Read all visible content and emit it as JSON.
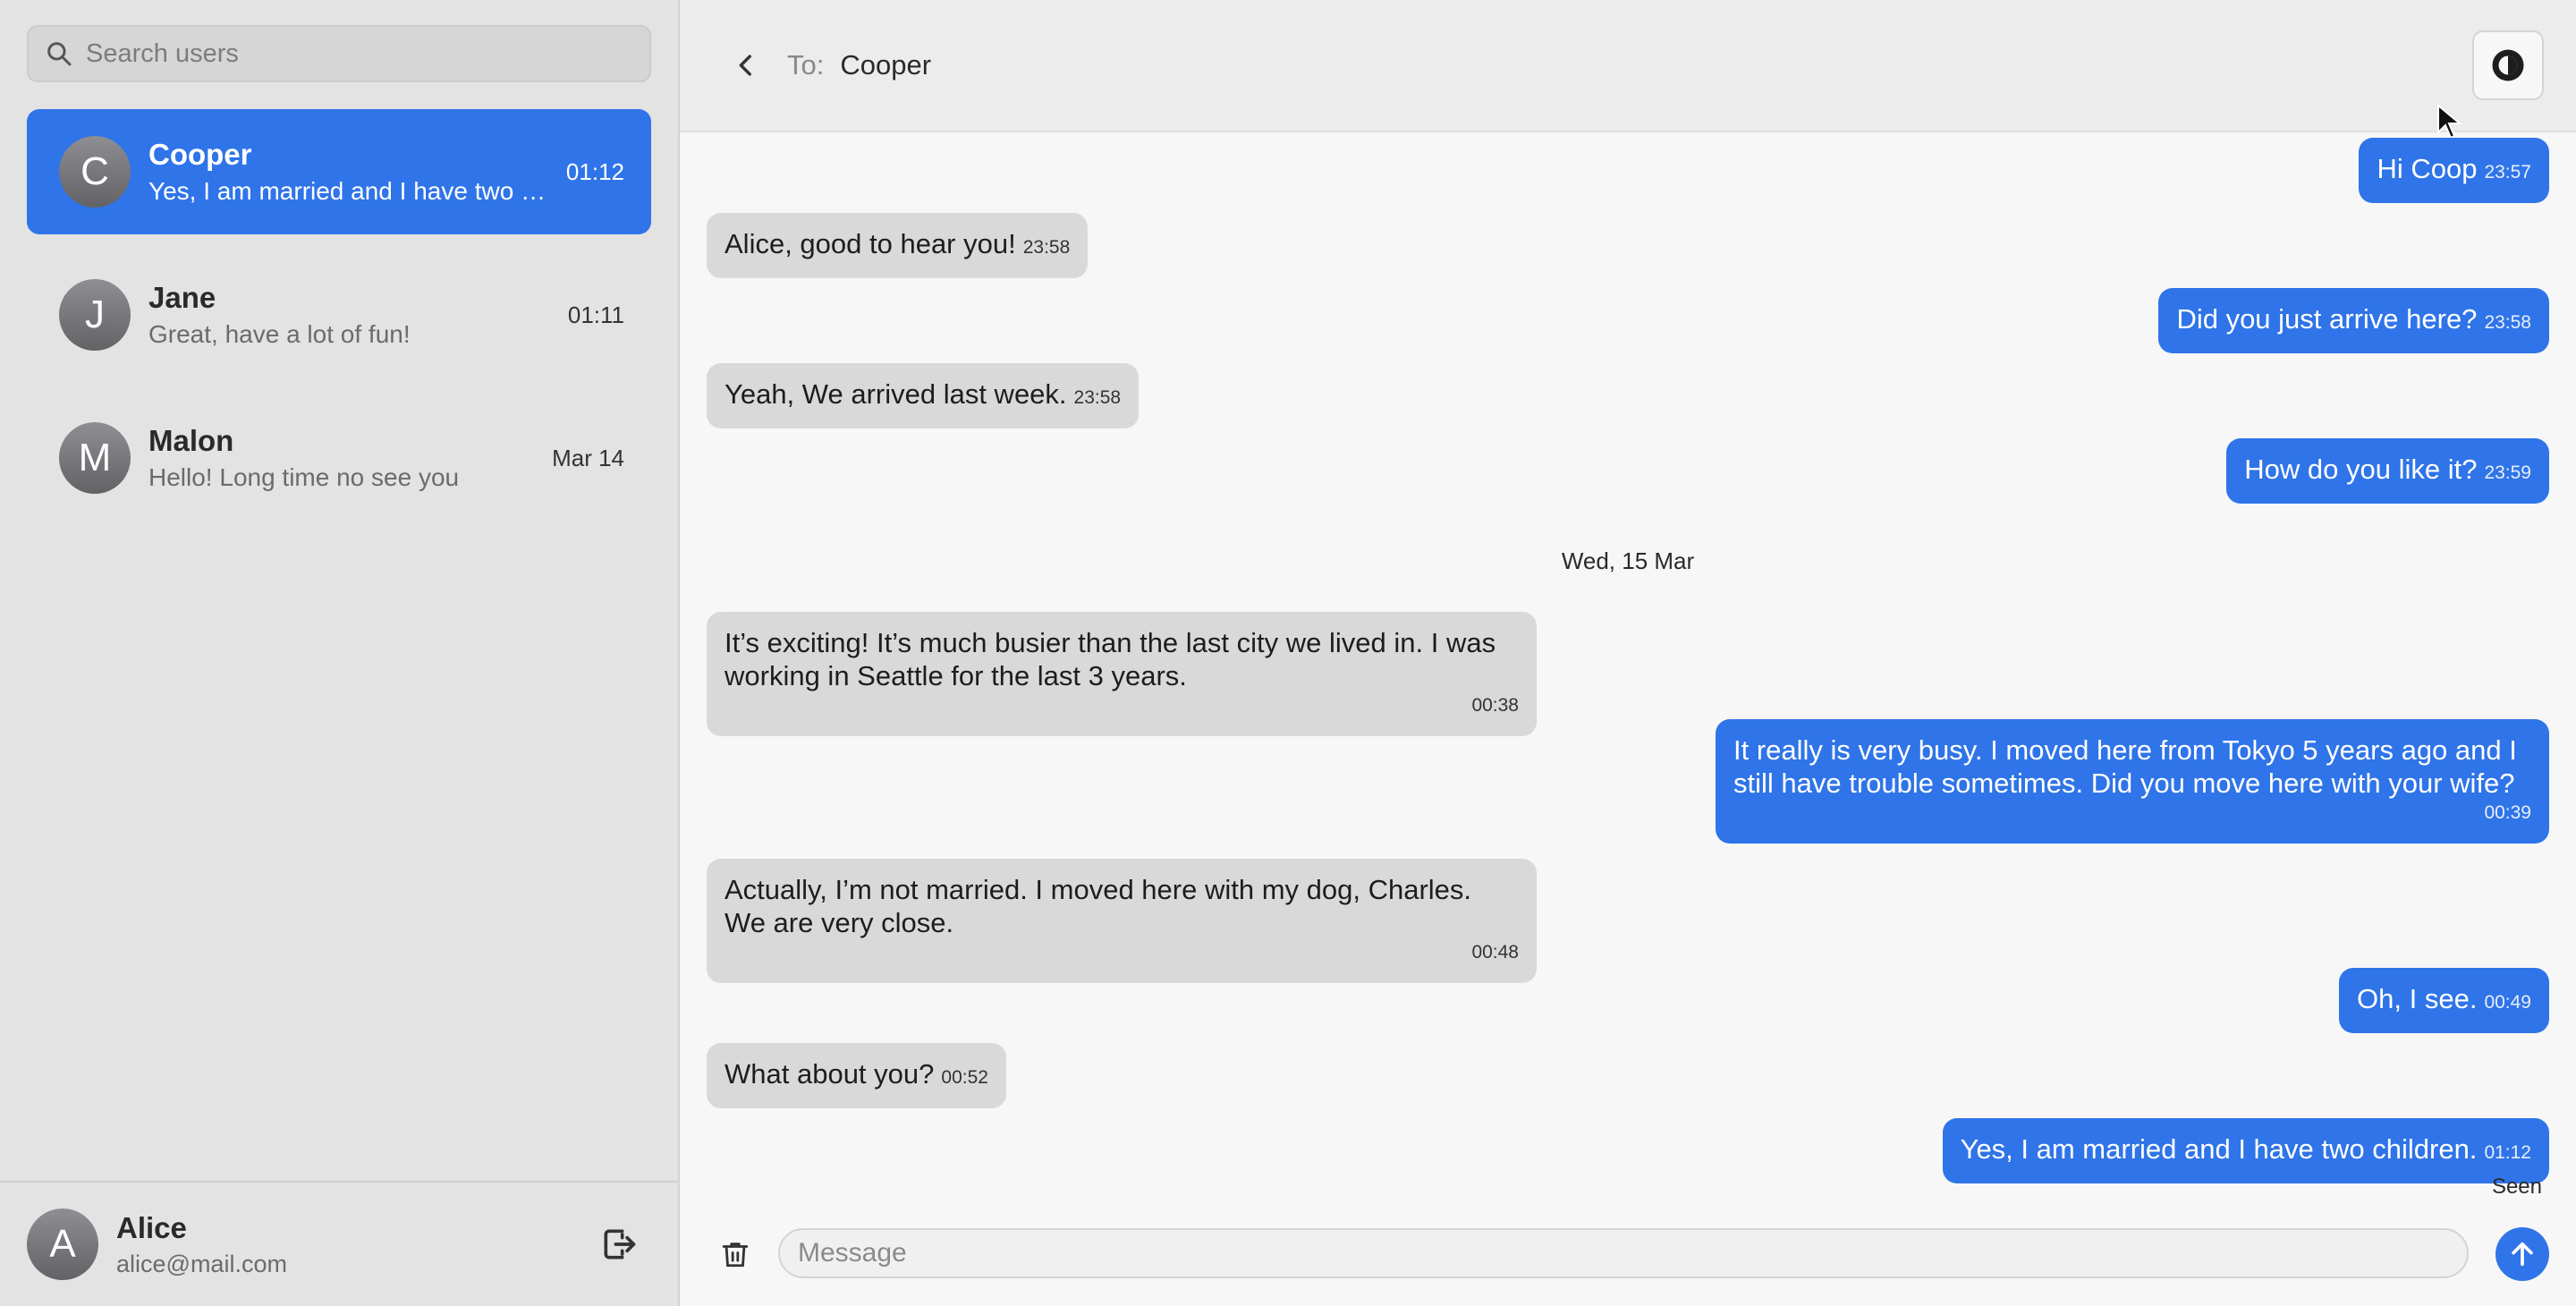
{
  "sidebar": {
    "search_placeholder": "Search users",
    "conversations": [
      {
        "initial": "C",
        "name": "Cooper",
        "preview": "Yes, I am married and I have two children.",
        "time": "01:12"
      },
      {
        "initial": "J",
        "name": "Jane",
        "preview": "Great, have a lot of fun!",
        "time": "01:11"
      },
      {
        "initial": "M",
        "name": "Malon",
        "preview": "Hello! Long time no see you",
        "time": "Mar 14"
      }
    ],
    "profile": {
      "initial": "A",
      "name": "Alice",
      "email": "alice@mail.com"
    }
  },
  "header": {
    "to_label": "To:",
    "to_name": "Cooper"
  },
  "messages": [
    {
      "dir": "out",
      "text": "Hi Coop",
      "time": "23:57"
    },
    {
      "dir": "in",
      "text": "Alice, good to hear you!",
      "time": "23:58"
    },
    {
      "dir": "out",
      "text": "Did you just arrive here?",
      "time": "23:58"
    },
    {
      "dir": "in",
      "text": "Yeah, We arrived last week.",
      "time": "23:58"
    },
    {
      "dir": "out",
      "text": "How do you like it?",
      "time": "23:59"
    },
    {
      "dir": "in",
      "text": "It’s exciting! It’s much busier than the last city we lived in. I was working in Seattle for the last 3 years.",
      "time": "00:38"
    },
    {
      "dir": "out",
      "text": "It really is very busy. I moved here from Tokyo 5 years ago and I still have trouble sometimes. Did you move here with your wife?",
      "time": "00:39"
    },
    {
      "dir": "in",
      "text": "Actually, I’m not married. I moved here with my dog, Charles. We are very close.",
      "time": "00:48"
    },
    {
      "dir": "out",
      "text": "Oh, I see.",
      "time": "00:49"
    },
    {
      "dir": "in",
      "text": "What about you?",
      "time": "00:52"
    },
    {
      "dir": "out",
      "text": "Yes, I am married and I have two children.",
      "time": "01:12"
    }
  ],
  "date_separator": "Wed, 15 Mar",
  "seen_label": "Seen",
  "composer": {
    "placeholder": "Message"
  },
  "colors": {
    "accent": "#2f74e8",
    "incoming_bubble": "#d9d9d9",
    "sidebar_bg": "#e3e3e3"
  },
  "icons": [
    "search-icon",
    "back-chevron-icon",
    "theme-toggle-icon",
    "logout-icon",
    "trash-icon",
    "send-arrow-icon"
  ]
}
